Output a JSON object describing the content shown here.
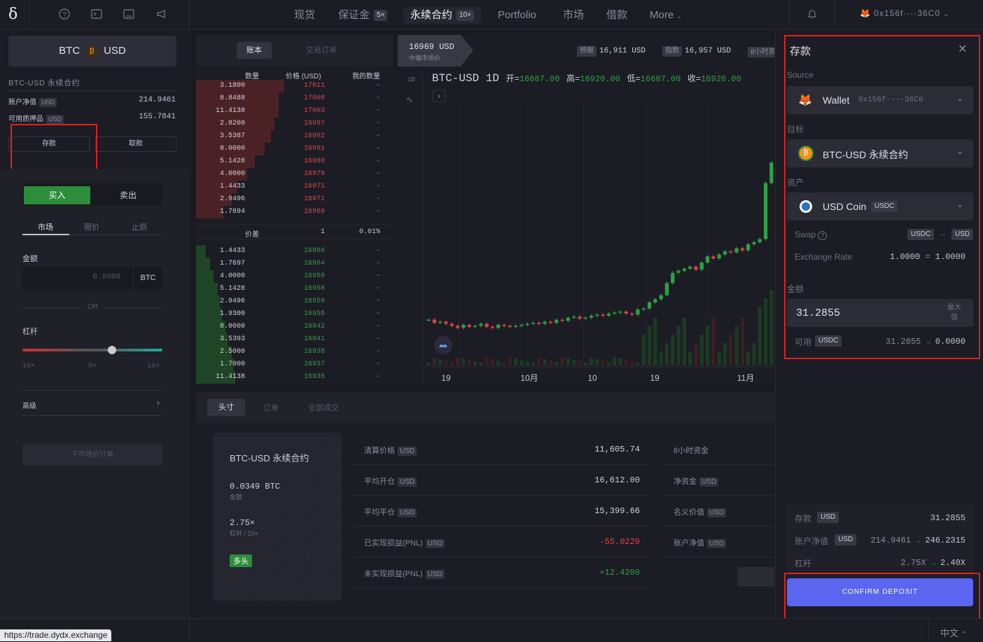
{
  "topbar": {
    "logo": "δ",
    "nav": [
      {
        "label": "现货"
      },
      {
        "label": "保证金",
        "badge": "5×"
      },
      {
        "label": "永续合约",
        "badge": "10×"
      },
      {
        "label": "Portfolio"
      },
      {
        "label": "市场"
      },
      {
        "label": "借款"
      },
      {
        "label": "More"
      }
    ],
    "wallet_address": "0x156f····36C0"
  },
  "left": {
    "market_base": "BTC",
    "market_quote": "USD",
    "market_name": "BTC-USD 永续合约",
    "equity_label": "账户净值",
    "equity_value": "214.9461",
    "collateral_label": "可用质押品",
    "collateral_value": "155.7841",
    "unit": "USD",
    "deposit_btn": "存款",
    "withdraw_btn": "取款",
    "buy": "买入",
    "sell": "卖出",
    "order_types": [
      "市场",
      "限价",
      "止损"
    ],
    "amount_label": "金额",
    "amount_placeholder": "0.0000",
    "amount_unit": "BTC",
    "or": "OR",
    "leverage_label": "杠杆",
    "lev_ticks": [
      "10×",
      "0×",
      "10×"
    ],
    "advanced": "高级",
    "place_order": "下市场价订单"
  },
  "orderbook": {
    "tabs": [
      "账本",
      "交易订单"
    ],
    "headers": [
      "数量",
      "价格 (USD)",
      "我的数量"
    ],
    "asks": [
      {
        "q": "3.1800",
        "p": "17011",
        "m": "-",
        "d": 0.45
      },
      {
        "q": "8.8488",
        "p": "17008",
        "m": "-",
        "d": 0.42
      },
      {
        "q": "11.4138",
        "p": "17003",
        "m": "-",
        "d": 0.42
      },
      {
        "q": "2.8200",
        "p": "16997",
        "m": "-",
        "d": 0.4
      },
      {
        "q": "3.5387",
        "p": "16992",
        "m": "-",
        "d": 0.38
      },
      {
        "q": "8.0000",
        "p": "16991",
        "m": "-",
        "d": 0.35
      },
      {
        "q": "5.1428",
        "p": "16980",
        "m": "-",
        "d": 0.3
      },
      {
        "q": "4.0000",
        "p": "16979",
        "m": "-",
        "d": 0.26
      },
      {
        "q": "1.4433",
        "p": "16971",
        "m": "-",
        "d": 0.21
      },
      {
        "q": "2.9496",
        "p": "16971",
        "m": "-",
        "d": 0.18
      },
      {
        "q": "1.7694",
        "p": "16969",
        "m": "-",
        "d": 0.14
      }
    ],
    "spread_label": "价差",
    "spread_value": "1",
    "spread_pct": "0.01%",
    "bids": [
      {
        "q": "1.4433",
        "p": "16968",
        "m": "-",
        "d": 0.05
      },
      {
        "q": "1.7697",
        "p": "16964",
        "m": "-",
        "d": 0.07
      },
      {
        "q": "4.0000",
        "p": "16959",
        "m": "-",
        "d": 0.09
      },
      {
        "q": "5.1428",
        "p": "16958",
        "m": "-",
        "d": 0.11
      },
      {
        "q": "2.9496",
        "p": "16958",
        "m": "-",
        "d": 0.12
      },
      {
        "q": "1.9300",
        "p": "16955",
        "m": "-",
        "d": 0.13
      },
      {
        "q": "8.0000",
        "p": "16942",
        "m": "-",
        "d": 0.15
      },
      {
        "q": "3.5393",
        "p": "16941",
        "m": "-",
        "d": 0.16
      },
      {
        "q": "2.5000",
        "p": "16938",
        "m": "-",
        "d": 0.18
      },
      {
        "q": "1.7000",
        "p": "16937",
        "m": "-",
        "d": 0.19
      },
      {
        "q": "11.4138",
        "p": "16935",
        "m": "-",
        "d": 0.2
      }
    ]
  },
  "chart": {
    "mid_price": "16969 USD",
    "mid_label": "中端市场价",
    "oracle_label": "预报",
    "oracle_value": "16,911 USD",
    "index_label": "指数",
    "index_value": "16,957 USD",
    "funding_label": "8小时资",
    "interval": "1D",
    "title": "BTC-USD  1D",
    "open_label": "开=",
    "open": "16687.00",
    "high_label": "高=",
    "high": "16920.00",
    "low_label": "低=",
    "low": "16687.00",
    "close_label": "收=",
    "close": "16920.00",
    "xticks": [
      "19",
      "10月",
      "10",
      "19",
      "11月"
    ],
    "up_color": "#2ea043",
    "down_color": "#e0424a"
  },
  "positions": {
    "tabs": [
      "头寸",
      "订单",
      "全部成交"
    ],
    "card_market": "BTC-USD 永续合约",
    "card_size": "0.0349 BTC",
    "card_size_label": "金额",
    "card_lev": "2.75×",
    "card_lev_label": "杠杆 / 10×",
    "side": "多头",
    "rows": [
      {
        "k": "清算价格",
        "u": "USD",
        "v": "11,605.74",
        "c": "#d0d0dc"
      },
      {
        "k": "平均开仓",
        "u": "USD",
        "v": "16,612.00",
        "c": "#d0d0dc"
      },
      {
        "k": "平均平仓",
        "u": "USD",
        "v": "15,399.66",
        "c": "#d0d0dc"
      },
      {
        "k": "已实现损益(PNL)",
        "u": "USD",
        "v": "-55.0229",
        "c": "#e0424a"
      },
      {
        "k": "未实现损益(PNL)",
        "u": "USD",
        "v": "+12.4209",
        "c": "#2ea043"
      }
    ],
    "rows2": [
      {
        "k": "8小时资金",
        "u": ""
      },
      {
        "k": "净资金",
        "u": "USD"
      },
      {
        "k": "名义价值",
        "u": "USD"
      },
      {
        "k": "账户净值",
        "u": "USD"
      }
    ]
  },
  "deposit": {
    "title": "存款",
    "source_label": "Source",
    "wallet_name": "Wallet",
    "wallet_addr": "0x156f····36C0",
    "target_label": "目标",
    "target_value": "BTC-USD 永续合约",
    "asset_label": "资产",
    "asset_name": "USD Coin",
    "asset_ticker": "USDC",
    "swap_label": "Swap",
    "swap_from": "USDC",
    "swap_to": "USD",
    "rate_label": "Exchange Rate",
    "rate_from": "1.0000",
    "rate_eq": "=",
    "rate_to": "1.0000",
    "amount_label": "金额",
    "amount_value": "31.2855",
    "max_label": "最大值",
    "avail_label": "可用",
    "avail_token": "USDC",
    "avail_from": "31.2855",
    "avail_to": "0.0000",
    "sum_deposit_label": "存款",
    "sum_deposit_unit": "USD",
    "sum_deposit_value": "31.2855",
    "sum_equity_label": "账户净值",
    "sum_equity_unit": "USD",
    "sum_equity_from": "214.9461",
    "sum_equity_to": "246.2315",
    "sum_lev_label": "杠杆",
    "sum_lev_from": "2.75X",
    "sum_lev_to": "2.40X",
    "confirm": "CONFIRM DEPOSIT"
  },
  "footer": {
    "url": "https://trade.dydx.exchange",
    "language": "中文"
  }
}
